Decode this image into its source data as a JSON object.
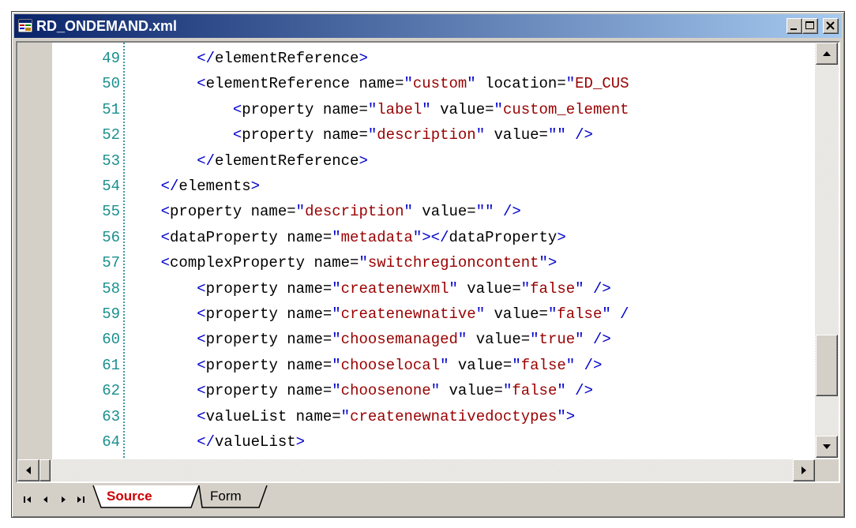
{
  "window": {
    "title": "RD_ONDEMAND.xml",
    "controls": [
      "minimize",
      "maximize",
      "close"
    ]
  },
  "editor": {
    "lines": [
      {
        "num": "49",
        "indent": "        ",
        "parts": [
          [
            "br",
            "</"
          ],
          [
            "tag",
            "elementReference"
          ],
          [
            "br",
            ">"
          ]
        ]
      },
      {
        "num": "50",
        "indent": "        ",
        "parts": [
          [
            "br",
            "<"
          ],
          [
            "tag",
            "elementReference name="
          ],
          [
            "br",
            "\""
          ],
          [
            "val",
            "custom"
          ],
          [
            "br",
            "\""
          ],
          [
            "tag",
            " location="
          ],
          [
            "br",
            "\""
          ],
          [
            "val",
            "ED_CUS"
          ]
        ]
      },
      {
        "num": "51",
        "indent": "            ",
        "parts": [
          [
            "br",
            "<"
          ],
          [
            "tag",
            "property name="
          ],
          [
            "br",
            "\""
          ],
          [
            "val",
            "label"
          ],
          [
            "br",
            "\""
          ],
          [
            "tag",
            " value="
          ],
          [
            "br",
            "\""
          ],
          [
            "val",
            "custom_element"
          ]
        ]
      },
      {
        "num": "52",
        "indent": "            ",
        "parts": [
          [
            "br",
            "<"
          ],
          [
            "tag",
            "property name="
          ],
          [
            "br",
            "\""
          ],
          [
            "val",
            "description"
          ],
          [
            "br",
            "\""
          ],
          [
            "tag",
            " value="
          ],
          [
            "br",
            "\"\""
          ],
          [
            "tag",
            " "
          ],
          [
            "br",
            "/>"
          ]
        ]
      },
      {
        "num": "53",
        "indent": "        ",
        "parts": [
          [
            "br",
            "</"
          ],
          [
            "tag",
            "elementReference"
          ],
          [
            "br",
            ">"
          ]
        ]
      },
      {
        "num": "54",
        "indent": "    ",
        "parts": [
          [
            "br",
            "</"
          ],
          [
            "tag",
            "elements"
          ],
          [
            "br",
            ">"
          ]
        ]
      },
      {
        "num": "55",
        "indent": "    ",
        "parts": [
          [
            "br",
            "<"
          ],
          [
            "tag",
            "property name="
          ],
          [
            "br",
            "\""
          ],
          [
            "val",
            "description"
          ],
          [
            "br",
            "\""
          ],
          [
            "tag",
            " value="
          ],
          [
            "br",
            "\"\""
          ],
          [
            "tag",
            " "
          ],
          [
            "br",
            "/>"
          ]
        ]
      },
      {
        "num": "56",
        "indent": "    ",
        "parts": [
          [
            "br",
            "<"
          ],
          [
            "tag",
            "dataProperty name="
          ],
          [
            "br",
            "\""
          ],
          [
            "val",
            "metadata"
          ],
          [
            "br",
            "\"></"
          ],
          [
            "tag",
            "dataProperty"
          ],
          [
            "br",
            ">"
          ]
        ]
      },
      {
        "num": "57",
        "indent": "    ",
        "parts": [
          [
            "br",
            "<"
          ],
          [
            "tag",
            "complexProperty name="
          ],
          [
            "br",
            "\""
          ],
          [
            "val",
            "switchregioncontent"
          ],
          [
            "br",
            "\">"
          ]
        ]
      },
      {
        "num": "58",
        "indent": "        ",
        "parts": [
          [
            "br",
            "<"
          ],
          [
            "tag",
            "property name="
          ],
          [
            "br",
            "\""
          ],
          [
            "val",
            "createnewxml"
          ],
          [
            "br",
            "\""
          ],
          [
            "tag",
            " value="
          ],
          [
            "br",
            "\""
          ],
          [
            "val",
            "false"
          ],
          [
            "br",
            "\""
          ],
          [
            "tag",
            " "
          ],
          [
            "br",
            "/>"
          ]
        ]
      },
      {
        "num": "59",
        "indent": "        ",
        "parts": [
          [
            "br",
            "<"
          ],
          [
            "tag",
            "property name="
          ],
          [
            "br",
            "\""
          ],
          [
            "val",
            "createnewnative"
          ],
          [
            "br",
            "\""
          ],
          [
            "tag",
            " value="
          ],
          [
            "br",
            "\""
          ],
          [
            "val",
            "false"
          ],
          [
            "br",
            "\""
          ],
          [
            "tag",
            " "
          ],
          [
            "br",
            "/"
          ]
        ]
      },
      {
        "num": "60",
        "indent": "        ",
        "parts": [
          [
            "br",
            "<"
          ],
          [
            "tag",
            "property name="
          ],
          [
            "br",
            "\""
          ],
          [
            "val",
            "choosemanaged"
          ],
          [
            "br",
            "\""
          ],
          [
            "tag",
            " value="
          ],
          [
            "br",
            "\""
          ],
          [
            "val",
            "true"
          ],
          [
            "br",
            "\""
          ],
          [
            "tag",
            " "
          ],
          [
            "br",
            "/>"
          ]
        ]
      },
      {
        "num": "61",
        "indent": "        ",
        "parts": [
          [
            "br",
            "<"
          ],
          [
            "tag",
            "property name="
          ],
          [
            "br",
            "\""
          ],
          [
            "val",
            "chooselocal"
          ],
          [
            "br",
            "\""
          ],
          [
            "tag",
            " value="
          ],
          [
            "br",
            "\""
          ],
          [
            "val",
            "false"
          ],
          [
            "br",
            "\""
          ],
          [
            "tag",
            " "
          ],
          [
            "br",
            "/>"
          ]
        ]
      },
      {
        "num": "62",
        "indent": "        ",
        "parts": [
          [
            "br",
            "<"
          ],
          [
            "tag",
            "property name="
          ],
          [
            "br",
            "\""
          ],
          [
            "val",
            "choosenone"
          ],
          [
            "br",
            "\""
          ],
          [
            "tag",
            " value="
          ],
          [
            "br",
            "\""
          ],
          [
            "val",
            "false"
          ],
          [
            "br",
            "\""
          ],
          [
            "tag",
            " "
          ],
          [
            "br",
            "/>"
          ]
        ]
      },
      {
        "num": "63",
        "indent": "        ",
        "parts": [
          [
            "br",
            "<"
          ],
          [
            "tag",
            "valueList name="
          ],
          [
            "br",
            "\""
          ],
          [
            "val",
            "createnewnativedoctypes"
          ],
          [
            "br",
            "\">"
          ]
        ]
      },
      {
        "num": "64",
        "indent": "        ",
        "parts": [
          [
            "br",
            "</"
          ],
          [
            "tag",
            "valueList"
          ],
          [
            "br",
            ">"
          ]
        ]
      }
    ]
  },
  "tabs": [
    {
      "label": "Source",
      "active": true,
      "color": "#cc0000"
    },
    {
      "label": "Form",
      "active": false,
      "color": "#000000"
    }
  ],
  "colors": {
    "titlebar_start": "#0a246a",
    "titlebar_end": "#a6caf0",
    "line_number": "#1a8f8f",
    "bracket": "#0000cc",
    "attr_value": "#990000"
  }
}
